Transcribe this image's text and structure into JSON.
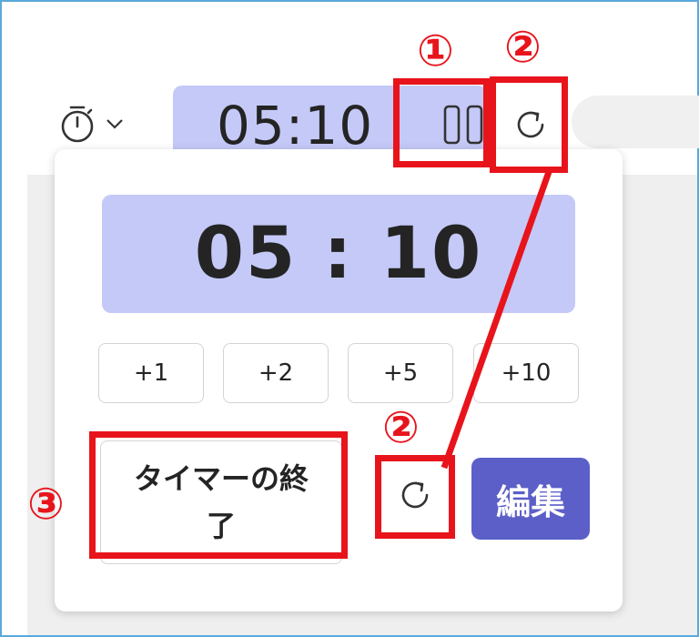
{
  "header": {
    "time_display": "05:10"
  },
  "popup": {
    "time_display": "05 : 10",
    "add_buttons": [
      "+1",
      "+2",
      "+5",
      "+10"
    ],
    "end_timer_label": "タイマーの終了",
    "edit_label": "編集"
  },
  "annotations": {
    "pause_marker": "①",
    "reset_marker_top": "②",
    "reset_marker_popup": "②",
    "end_marker": "③"
  },
  "icons": {
    "timer": "stopwatch-icon",
    "dropdown": "chevron-down-icon",
    "pause": "pause-icon",
    "reset": "reset-icon"
  },
  "colors": {
    "accent": "#5b5fc7",
    "time_highlight": "#c4c9f7",
    "annotation_red": "#e8141c",
    "frame_border": "#5aa9dc"
  }
}
